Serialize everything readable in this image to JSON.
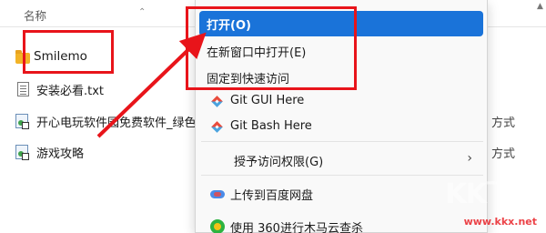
{
  "explorer": {
    "column_name": "名称",
    "files": [
      {
        "name": "Smilemo",
        "kind": "folder",
        "icon": "folder-icon"
      },
      {
        "name": "安装必看.txt",
        "kind": "text",
        "icon": "text-file-icon"
      },
      {
        "name": "开心电玩软件园免费软件_绿色软",
        "kind": "shortcut",
        "icon": "internet-shortcut-icon",
        "type": "方式"
      },
      {
        "name": "游戏攻略",
        "kind": "shortcut",
        "icon": "internet-shortcut-icon",
        "type": "方式"
      }
    ]
  },
  "context_menu": {
    "items": [
      {
        "label": "打开(O)",
        "selected": true
      },
      {
        "label": "在新窗口中打开(E)"
      },
      {
        "label": "固定到快速访问"
      },
      {
        "label": "Git GUI Here",
        "icon": "git-icon"
      },
      {
        "label": "Git Bash Here",
        "icon": "git-icon"
      },
      {
        "label": "授予访问权限(G)",
        "has_submenu": true
      },
      {
        "label": "上传到百度网盘",
        "icon": "baidu-netdisk-icon"
      },
      {
        "label": "使用 360进行木马云查杀",
        "icon": "360-icon"
      }
    ]
  },
  "annotation": {
    "color": "#e8141a"
  },
  "watermark": {
    "logo": "KK下载",
    "url": "www.kkx.net"
  }
}
